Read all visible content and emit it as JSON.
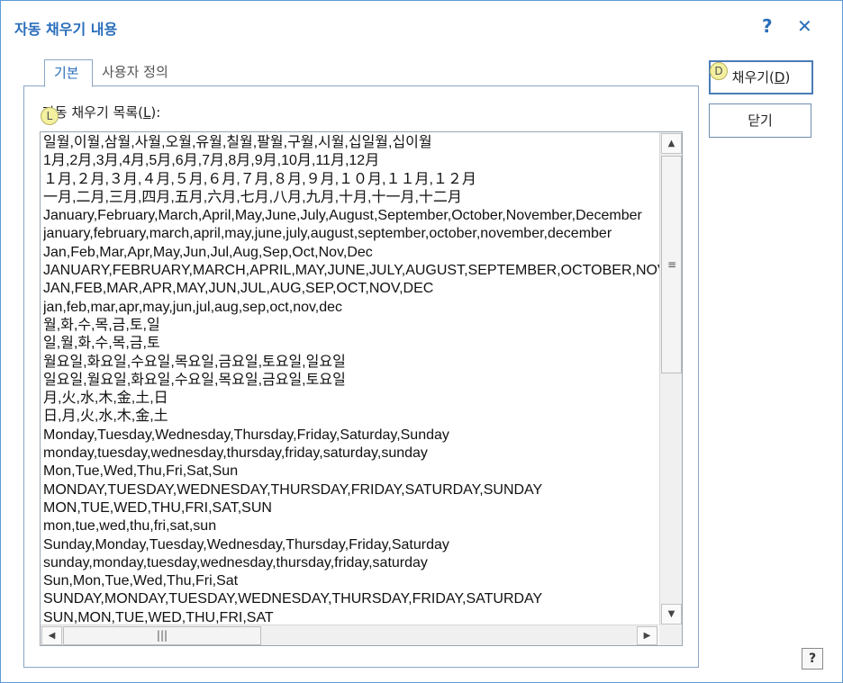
{
  "window": {
    "title": "자동 채우기 내용",
    "help_glyph": "?",
    "close_glyph": "✕"
  },
  "tabs": [
    {
      "label": "기본",
      "active": true
    },
    {
      "label": "사용자 정의",
      "active": false
    }
  ],
  "autofill": {
    "label_prefix": "자동 채우기 목록(",
    "label_key": "L",
    "label_suffix": "):",
    "badge": "L",
    "items": [
      "일월,이월,삼월,사월,오월,유월,칠월,팔월,구월,시월,십일월,십이월",
      "1月,2月,3月,4月,5月,6月,7月,8月,9月,10月,11月,12月",
      "１月,２月,３月,４月,５月,６月,７月,８月,９月,１０月,１１月,１２月",
      "一月,二月,三月,四月,五月,六月,七月,八月,九月,十月,十一月,十二月",
      "January,February,March,April,May,June,July,August,September,October,November,December",
      "january,february,march,april,may,june,july,august,september,october,november,december",
      "Jan,Feb,Mar,Apr,May,Jun,Jul,Aug,Sep,Oct,Nov,Dec",
      "JANUARY,FEBRUARY,MARCH,APRIL,MAY,JUNE,JULY,AUGUST,SEPTEMBER,OCTOBER,NOVEMBER,DECEMBER",
      "JAN,FEB,MAR,APR,MAY,JUN,JUL,AUG,SEP,OCT,NOV,DEC",
      "jan,feb,mar,apr,may,jun,jul,aug,sep,oct,nov,dec",
      "월,화,수,목,금,토,일",
      "일,월,화,수,목,금,토",
      "월요일,화요일,수요일,목요일,금요일,토요일,일요일",
      "일요일,월요일,화요일,수요일,목요일,금요일,토요일",
      "月,火,水,木,金,土,日",
      "日,月,火,水,木,金,土",
      "Monday,Tuesday,Wednesday,Thursday,Friday,Saturday,Sunday",
      "monday,tuesday,wednesday,thursday,friday,saturday,sunday",
      "Mon,Tue,Wed,Thu,Fri,Sat,Sun",
      "MONDAY,TUESDAY,WEDNESDAY,THURSDAY,FRIDAY,SATURDAY,SUNDAY",
      "MON,TUE,WED,THU,FRI,SAT,SUN",
      "mon,tue,wed,thu,fri,sat,sun",
      "Sunday,Monday,Tuesday,Wednesday,Thursday,Friday,Saturday",
      "sunday,monday,tuesday,wednesday,thursday,friday,saturday",
      "Sun,Mon,Tue,Wed,Thu,Fri,Sat",
      "SUNDAY,MONDAY,TUESDAY,WEDNESDAY,THURSDAY,FRIDAY,SATURDAY",
      "SUN,MON,TUE,WED,THU,FRI,SAT"
    ]
  },
  "scrollbars": {
    "up": "▲",
    "down": "▼",
    "left": "◀",
    "right": "▶",
    "vgrip": "≡",
    "hgrip": "|||"
  },
  "buttons": {
    "fill_prefix": "채우기(",
    "fill_key": "D",
    "fill_suffix": ")",
    "fill_badge": "D",
    "close": "닫기",
    "help": "?"
  }
}
